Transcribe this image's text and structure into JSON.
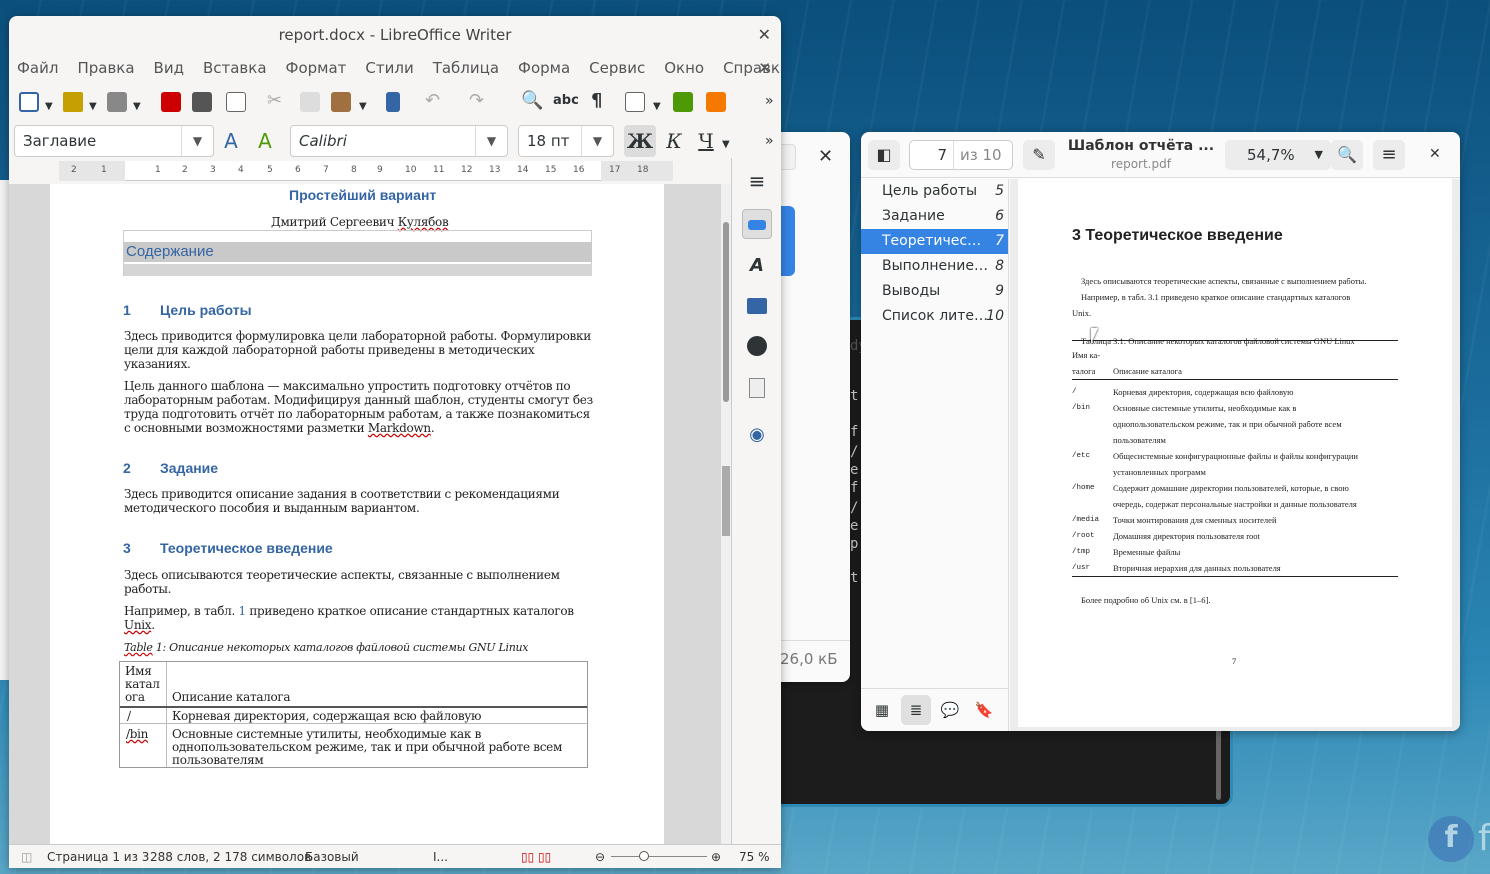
{
  "writer": {
    "title": "report.docx - LibreOffice Writer",
    "menu": [
      "Файл",
      "Правка",
      "Вид",
      "Вставка",
      "Формат",
      "Стили",
      "Таблица",
      "Форма",
      "Сервис",
      "Окно",
      "Справка"
    ],
    "para_style": "Заглавие",
    "font_name": "Calibri",
    "font_size": "18 пт",
    "bold": "Ж",
    "italic": "К",
    "underline": "Ч",
    "ruler": [
      "2",
      "1",
      "1",
      "2",
      "3",
      "4",
      "5",
      "6",
      "7",
      "8",
      "9",
      "10",
      "11",
      "12",
      "13",
      "14",
      "15",
      "16",
      "17",
      "18"
    ],
    "doc": {
      "title": "Простейший вариант",
      "author_name": "Дмитрий Сергеевич ",
      "author_surname": "Кулябов",
      "toc": "Содержание",
      "s1_num": "1",
      "s1": "Цель работы",
      "p1": "Здесь приводится формулировка цели лабораторной работы. Формулировки цели для каждой лабораторной работы приведены в методических указаниях.",
      "p2": "Цель данного шаблона — максимально упростить подготовку отчётов по лабораторным работам. Модифицируя данный шаблон, студенты смогут без труда подготовить отчёт по лабораторным работам, а также познакомиться с основными возможностями разметки ",
      "p2_markdown": "Markdown",
      "s2_num": "2",
      "s2": "Задание",
      "p3": "Здесь приводится описание задания в соответствии с рекомендациями методического пособия и выданным вариантом.",
      "s3_num": "3",
      "s3": "Теоретическое введение",
      "p4": "Здесь описываются теоретические аспекты, связанные с выполнением работы.",
      "p5a": "Например, в табл. ",
      "p5ref": "1",
      "p5b": " приведено краткое описание стандартных каталогов ",
      "p5c": "Unix",
      "caption_table": "Table",
      "caption": " 1: Описание некоторых каталогов файловой системы GNU Linux",
      "th1": "Имя катал ога",
      "th2": "Описание каталога",
      "r1c1": "/",
      "r1c2": "Корневая директория, содержащая всю файловую",
      "r2c1": "/bin",
      "r2c2": "Основные системные утилиты, необходимые как в однопользовательском режиме, так и при обычной работе всем пользователям"
    },
    "status": {
      "page": "Страница 1 из 3",
      "words": "288 слов, 2 178 символов",
      "style": "Базовый",
      "zoom": "75 %"
    }
  },
  "bg": {
    "size": "26,0 кБ"
  },
  "evince": {
    "page_input": "7",
    "page_of": "из 10",
    "title": "Шаблон отчёта ...",
    "subtitle": "report.pdf",
    "zoom": "54,7%",
    "outline": [
      {
        "label": "Цель работы",
        "page": "5"
      },
      {
        "label": "Задание",
        "page": "6"
      },
      {
        "label": "Теоретичес…",
        "page": "7"
      },
      {
        "label": "Выполнение…",
        "page": "8"
      },
      {
        "label": "Выводы",
        "page": "9"
      },
      {
        "label": "Список лите…",
        "page": "10"
      }
    ],
    "pdf": {
      "heading": "3  Теоретическое введение",
      "l1": "Здесь описываются теоретические аспекты, связанные с выполнением работы.",
      "l2": "Например, в табл. 3.1 приведено краткое описание стандартных каталогов",
      "l3": "Unix.",
      "cap": "Таблица 3.1: Описание некоторых каталогов файловой системы GNU Linux",
      "h1a": "Имя ка-",
      "h1b": "талога",
      "h2": "Описание каталога",
      "rows": [
        [
          "/",
          "Корневая директория, содержащая всю файловую"
        ],
        [
          "/bin",
          "Основные системные утилиты, необходимые как в"
        ],
        [
          "",
          "однопользовательском режиме, так и при обычной работе всем"
        ],
        [
          "",
          "пользователям"
        ],
        [
          "/etc",
          "Общесистемные конфигурационные файлы и файлы конфигурации"
        ],
        [
          "",
          "установленных программ"
        ],
        [
          "/home",
          "Содержит домашние директории пользователей, которые, в свою"
        ],
        [
          "",
          "очередь, содержат персональные настройки и данные пользователя"
        ],
        [
          "/media",
          "Точки монтирования для сменных носителей"
        ],
        [
          "/root",
          "Домашняя директория пользователя root"
        ],
        [
          "/tmp",
          "Временные файлы"
        ],
        [
          "/usr",
          "Вторичная иерархия для данных пользователя"
        ]
      ],
      "more": "Более подробно об Unix см. в [1–6].",
      "pagenum": "7"
    }
  }
}
